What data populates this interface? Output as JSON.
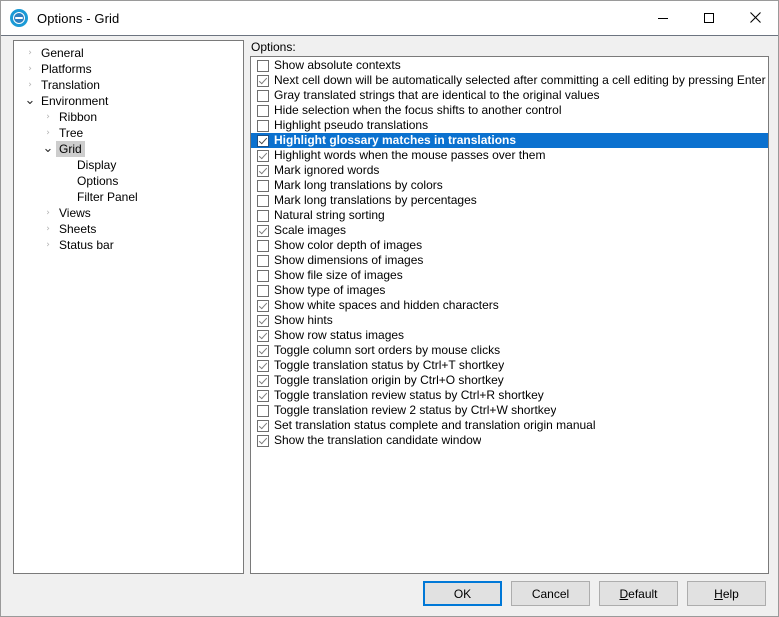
{
  "window": {
    "title": "Options - Grid",
    "icon": "options-circle-icon",
    "controls": [
      {
        "name": "minimize-button",
        "glyph": "minimize"
      },
      {
        "name": "maximize-button",
        "glyph": "maximize"
      },
      {
        "name": "close-button",
        "glyph": "close"
      }
    ]
  },
  "colors": {
    "selection_blue": "#0b71cf",
    "focus_blue": "#0078d7",
    "tree_selection_gray": "#cdcdcd",
    "dialog_background": "#f0f0f0",
    "panel_background": "#ffffff"
  },
  "tree": {
    "items": [
      {
        "label": "General",
        "level": 0,
        "state": "collapsed",
        "selected": false
      },
      {
        "label": "Platforms",
        "level": 0,
        "state": "collapsed",
        "selected": false
      },
      {
        "label": "Translation",
        "level": 0,
        "state": "collapsed",
        "selected": false
      },
      {
        "label": "Environment",
        "level": 0,
        "state": "expanded",
        "selected": false
      },
      {
        "label": "Ribbon",
        "level": 1,
        "state": "collapsed",
        "selected": false
      },
      {
        "label": "Tree",
        "level": 1,
        "state": "collapsed",
        "selected": false
      },
      {
        "label": "Grid",
        "level": 1,
        "state": "expanded",
        "selected": true
      },
      {
        "label": "Display",
        "level": 2,
        "state": "leaf",
        "selected": false
      },
      {
        "label": "Options",
        "level": 2,
        "state": "leaf",
        "selected": false
      },
      {
        "label": "Filter Panel",
        "level": 2,
        "state": "leaf",
        "selected": false
      },
      {
        "label": "Views",
        "level": 1,
        "state": "collapsed",
        "selected": false
      },
      {
        "label": "Sheets",
        "level": 1,
        "state": "collapsed",
        "selected": false
      },
      {
        "label": "Status bar",
        "level": 1,
        "state": "collapsed",
        "selected": false
      }
    ]
  },
  "options": {
    "label": "Options:",
    "items": [
      {
        "label": "Show absolute contexts",
        "checked": false,
        "selected": false
      },
      {
        "label": "Next cell down will be automatically selected after committing a cell editing by pressing Enter key",
        "checked": true,
        "selected": false
      },
      {
        "label": "Gray translated strings that are identical to the original values",
        "checked": false,
        "selected": false
      },
      {
        "label": "Hide selection when the focus shifts to another control",
        "checked": false,
        "selected": false
      },
      {
        "label": "Highlight pseudo translations",
        "checked": false,
        "selected": false
      },
      {
        "label": "Highlight glossary matches in translations",
        "checked": true,
        "selected": true
      },
      {
        "label": "Highlight words when the mouse passes over them",
        "checked": true,
        "selected": false
      },
      {
        "label": "Mark ignored words",
        "checked": true,
        "selected": false
      },
      {
        "label": "Mark long translations by colors",
        "checked": false,
        "selected": false
      },
      {
        "label": "Mark long translations by percentages",
        "checked": false,
        "selected": false
      },
      {
        "label": "Natural string sorting",
        "checked": false,
        "selected": false
      },
      {
        "label": "Scale images",
        "checked": true,
        "selected": false
      },
      {
        "label": "Show color depth of images",
        "checked": false,
        "selected": false
      },
      {
        "label": "Show dimensions of images",
        "checked": false,
        "selected": false
      },
      {
        "label": "Show file size of images",
        "checked": false,
        "selected": false
      },
      {
        "label": "Show type of images",
        "checked": false,
        "selected": false
      },
      {
        "label": "Show white spaces and hidden characters",
        "checked": true,
        "selected": false
      },
      {
        "label": "Show hints",
        "checked": true,
        "selected": false
      },
      {
        "label": "Show row status images",
        "checked": true,
        "selected": false
      },
      {
        "label": "Toggle column sort orders by mouse clicks",
        "checked": true,
        "selected": false
      },
      {
        "label": "Toggle translation status by Ctrl+T shortkey",
        "checked": true,
        "selected": false
      },
      {
        "label": "Toggle translation origin by Ctrl+O shortkey",
        "checked": true,
        "selected": false
      },
      {
        "label": "Toggle translation review status by Ctrl+R shortkey",
        "checked": true,
        "selected": false
      },
      {
        "label": "Toggle translation review 2 status by Ctrl+W shortkey",
        "checked": false,
        "selected": false
      },
      {
        "label": "Set translation status complete and translation origin manual",
        "checked": true,
        "selected": false
      },
      {
        "label": "Show the translation candidate window",
        "checked": true,
        "selected": false
      }
    ]
  },
  "buttons": [
    {
      "name": "ok-button",
      "label": "OK",
      "mnemonic": "",
      "default": true
    },
    {
      "name": "cancel-button",
      "label": "Cancel",
      "mnemonic": "",
      "default": false
    },
    {
      "name": "default-button",
      "label": "Default",
      "mnemonic": "D",
      "default": false
    },
    {
      "name": "help-button",
      "label": "Help",
      "mnemonic": "H",
      "default": false
    }
  ]
}
